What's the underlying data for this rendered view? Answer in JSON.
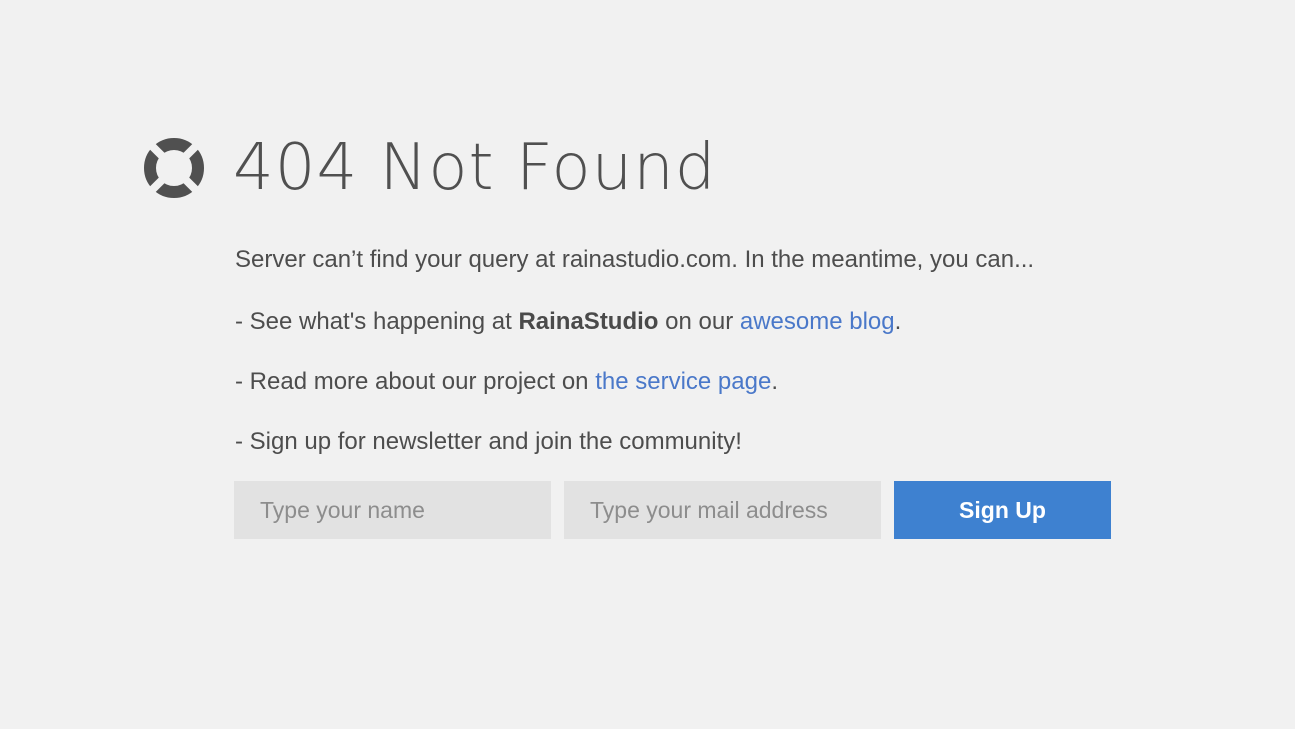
{
  "heading": {
    "title": "404 Not Found",
    "icon": "lifebuoy-icon"
  },
  "message": {
    "intro": "Server can’t find your query at rainastudio.com. In the meantime, you can...",
    "line1_prefix": "- See what's happening at ",
    "line1_brand": "RainaStudio",
    "line1_middle": " on our ",
    "line1_link": "awesome blog",
    "line1_suffix": ".",
    "line2_prefix": "- Read more about our project on ",
    "line2_link": "the service page",
    "line2_suffix": ".",
    "line3": "- Sign up for newsletter and join the community!"
  },
  "signup_form": {
    "name_placeholder": "Type your name",
    "name_value": "",
    "email_placeholder": "Type your mail address",
    "email_value": "",
    "submit_label": "Sign Up"
  },
  "colors": {
    "background": "#f1f1f1",
    "text": "#4d4d4d",
    "link": "#4a78c9",
    "button": "#3e81d0",
    "input_bg": "#e2e2e2"
  }
}
